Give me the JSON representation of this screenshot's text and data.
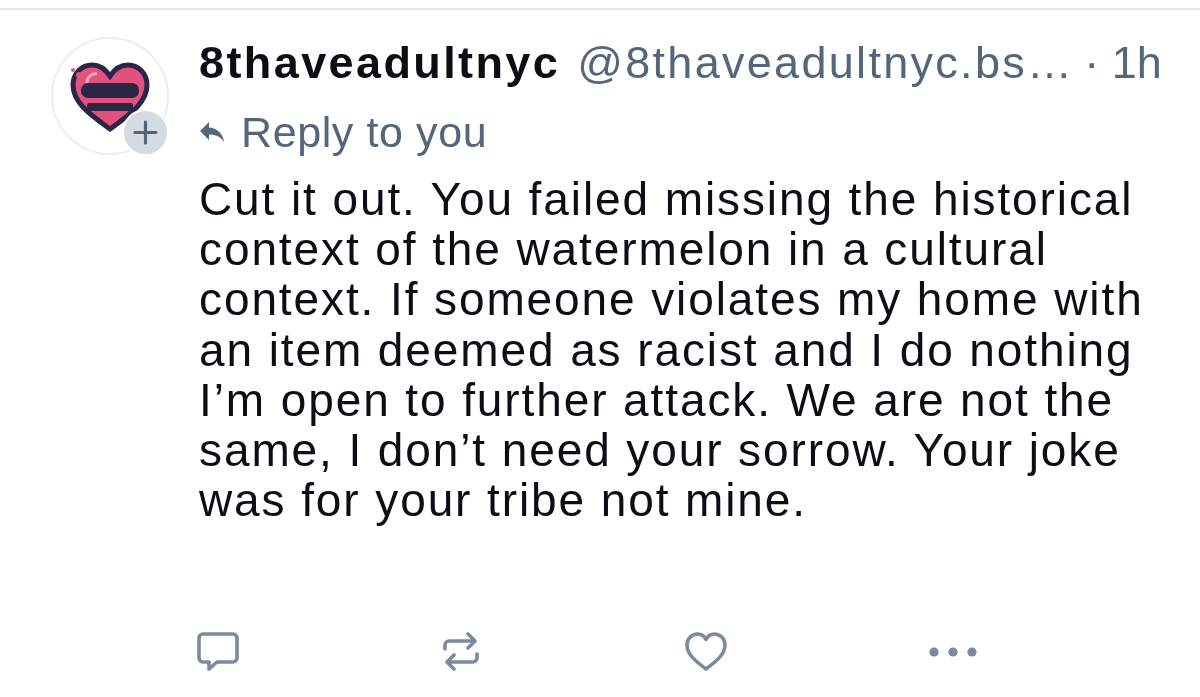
{
  "post": {
    "author": {
      "display_name": "8thaveadultnyc",
      "handle": "@8thaveadultnyc.bs…",
      "time": "· 1h",
      "follow_badge": true
    },
    "reply_label": "Reply to you",
    "body_lines": [
      "Cut it out. You failed missing the historical",
      "context of the watermelon in a cultural",
      "context. If someone violates my home with",
      "an item deemed as racist and I do nothing",
      "I’m open to further attack. We are not the",
      "same, I don’t need your sorrow. Your joke",
      "was for your tribe not mine."
    ],
    "actions": [
      {
        "kind": "reply"
      },
      {
        "kind": "repost"
      },
      {
        "kind": "like"
      },
      {
        "kind": "more"
      }
    ]
  }
}
